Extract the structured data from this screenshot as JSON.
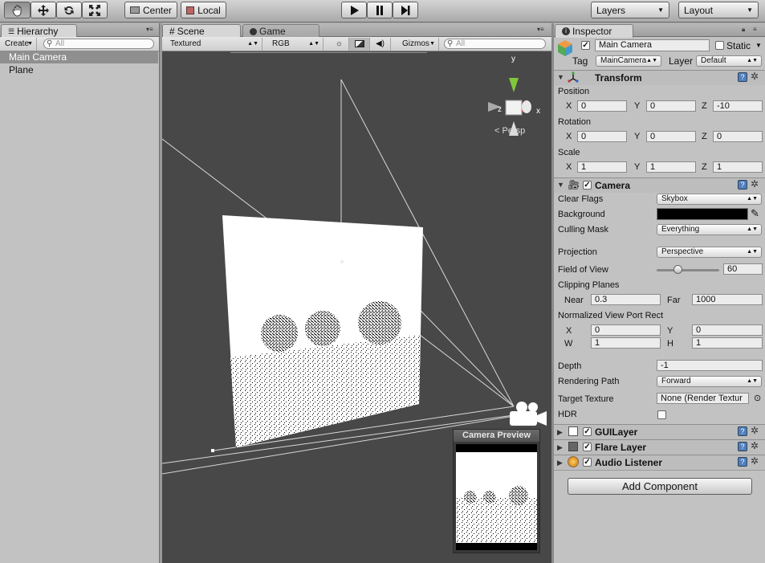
{
  "toolbar": {
    "pivot_label": "Center",
    "space_label": "Local",
    "layers_label": "Layers",
    "layout_label": "Layout"
  },
  "hierarchy": {
    "tab_label": "Hierarchy",
    "create_label": "Create",
    "search_placeholder": "All",
    "items": [
      {
        "label": "Main Camera",
        "selected": true
      },
      {
        "label": "Plane",
        "selected": false
      }
    ]
  },
  "scene": {
    "tabs": [
      {
        "label": "Scene",
        "active": true
      },
      {
        "label": "Game",
        "active": false
      }
    ],
    "render_mode": "Textured",
    "color_mode": "RGB",
    "gizmos_label": "Gizmos",
    "search_placeholder": "All",
    "gizmo_axes": {
      "y": "y",
      "z": "z",
      "x": "x"
    },
    "projection_label": "Persp",
    "camera_preview_title": "Camera Preview"
  },
  "inspector": {
    "tab_label": "Inspector",
    "object_name": "Main Camera",
    "static_label": "Static",
    "tag_label": "Tag",
    "tag_value": "MainCamera",
    "layer_label": "Layer",
    "layer_value": "Default",
    "transform": {
      "title": "Transform",
      "position_label": "Position",
      "rotation_label": "Rotation",
      "scale_label": "Scale",
      "axis_x": "X",
      "axis_y": "Y",
      "axis_z": "Z",
      "position": {
        "x": "0",
        "y": "0",
        "z": "-10"
      },
      "rotation": {
        "x": "0",
        "y": "0",
        "z": "0"
      },
      "scale": {
        "x": "1",
        "y": "1",
        "z": "1"
      }
    },
    "camera": {
      "title": "Camera",
      "clear_flags_label": "Clear Flags",
      "clear_flags_value": "Skybox",
      "background_label": "Background",
      "background_color": "#000000",
      "culling_mask_label": "Culling Mask",
      "culling_mask_value": "Everything",
      "projection_label": "Projection",
      "projection_value": "Perspective",
      "fov_label": "Field of View",
      "fov_value": "60",
      "fov_fraction": 0.33,
      "clipping_label": "Clipping Planes",
      "near_label": "Near",
      "near_value": "0.3",
      "far_label": "Far",
      "far_value": "1000",
      "viewport_label": "Normalized View Port Rect",
      "vp_x_label": "X",
      "vp_x": "0",
      "vp_y_label": "Y",
      "vp_y": "0",
      "vp_w_label": "W",
      "vp_w": "1",
      "vp_h_label": "H",
      "vp_h": "1",
      "depth_label": "Depth",
      "depth_value": "-1",
      "rendering_path_label": "Rendering Path",
      "rendering_path_value": "Forward",
      "target_texture_label": "Target Texture",
      "target_texture_value": "None (Render Textur",
      "hdr_label": "HDR"
    },
    "components": [
      {
        "title": "GUILayer"
      },
      {
        "title": "Flare Layer"
      },
      {
        "title": "Audio Listener"
      }
    ],
    "add_component_label": "Add Component",
    "help_glyph": "?",
    "gear_glyph": "✲"
  }
}
